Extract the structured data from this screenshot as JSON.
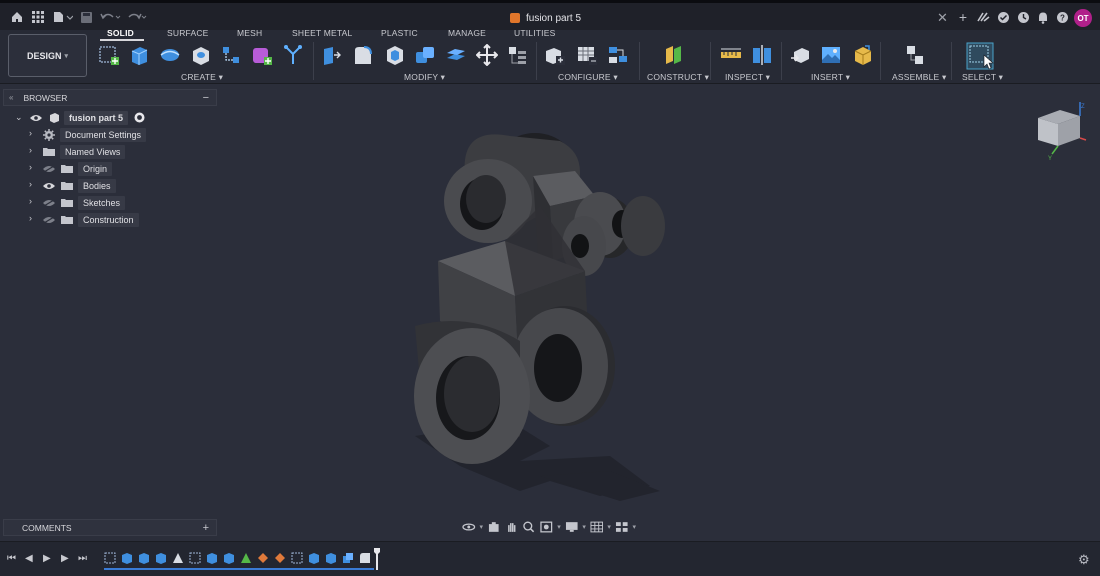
{
  "titlebar": {
    "doc_title": "fusion part 5",
    "avatar_initials": "OT",
    "icons": [
      "home-icon",
      "grid-icon",
      "file-icon",
      "save-icon",
      "undo-icon",
      "redo-icon",
      "close-icon",
      "plus-icon",
      "extensions-icon",
      "job-status-icon",
      "notifications-icon",
      "help-icon"
    ]
  },
  "toolbar": {
    "workspace": "DESIGN",
    "tabs": [
      "SOLID",
      "SURFACE",
      "MESH",
      "SHEET METAL",
      "PLASTIC",
      "MANAGE",
      "UTILITIES"
    ],
    "active_tab": "SOLID",
    "groups": [
      "CREATE",
      "MODIFY",
      "CONFIGURE",
      "CONSTRUCT",
      "INSPECT",
      "INSERT",
      "ASSEMBLE",
      "SELECT"
    ]
  },
  "browser": {
    "title": "BROWSER",
    "root": "fusion part 5",
    "items": [
      {
        "label": "Document Settings",
        "icon": "gear-icon"
      },
      {
        "label": "Named Views",
        "icon": "folder-icon"
      },
      {
        "label": "Origin",
        "icon": "folder-icon",
        "visibility": "hidden"
      },
      {
        "label": "Bodies",
        "icon": "folder-icon",
        "visibility": "visible"
      },
      {
        "label": "Sketches",
        "icon": "folder-icon",
        "visibility": "hidden"
      },
      {
        "label": "Construction",
        "icon": "folder-icon",
        "visibility": "hidden"
      }
    ]
  },
  "comments": {
    "title": "COMMENTS"
  },
  "viewcube": {
    "faces": [
      "FRONT",
      "RIGHT",
      "TOP"
    ],
    "axes": [
      "Z",
      "Y",
      "X"
    ]
  },
  "colors": {
    "accent": "#3a7bd5",
    "brand_orange": "#e0762b",
    "avatar": "#b0208a",
    "viewport_bg": "#2b2e3a"
  }
}
